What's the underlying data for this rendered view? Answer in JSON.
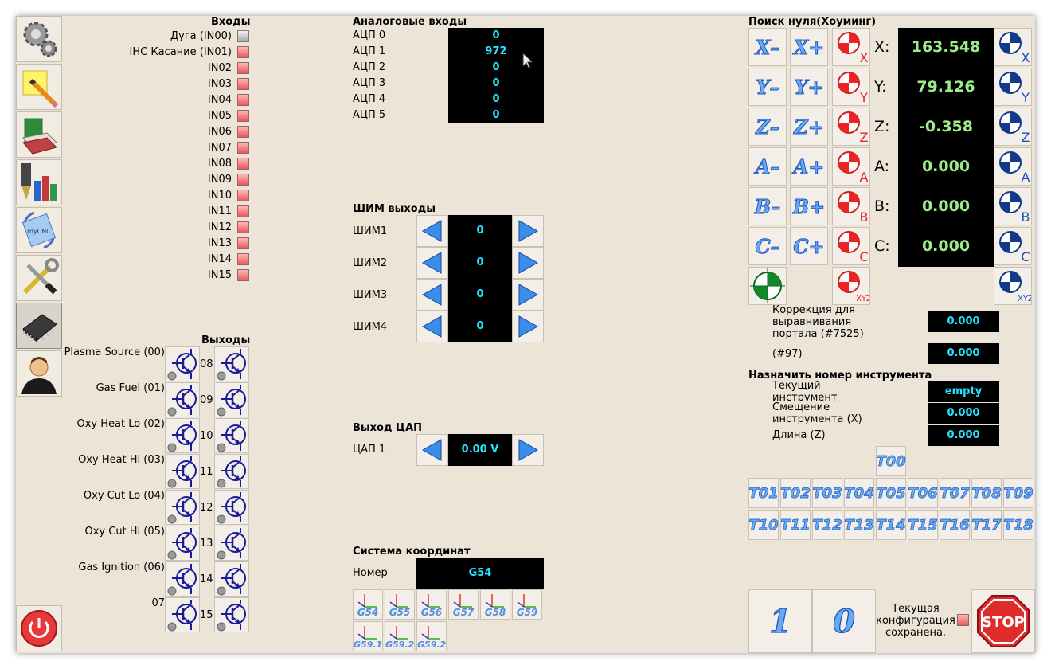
{
  "toolbar": {
    "items": [
      {
        "name": "settings-gears-icon"
      },
      {
        "name": "notes-pencil-icon"
      },
      {
        "name": "books-icon"
      },
      {
        "name": "tool-library-icon"
      },
      {
        "name": "mycnc-rotate-icon"
      },
      {
        "name": "tools-wrench-icon"
      },
      {
        "name": "chip-icon"
      },
      {
        "name": "user-icon"
      }
    ],
    "mycnc_label": "myCNC",
    "power_icon": "power-icon"
  },
  "inputs": {
    "title": "Входы",
    "items": [
      {
        "label": "Дуга (IN00)",
        "state": "gray"
      },
      {
        "label": "IHC Касание (IN01)",
        "state": "red"
      },
      {
        "label": "IN02",
        "state": "red"
      },
      {
        "label": "IN03",
        "state": "red"
      },
      {
        "label": "IN04",
        "state": "red"
      },
      {
        "label": "IN05",
        "state": "red"
      },
      {
        "label": "IN06",
        "state": "red"
      },
      {
        "label": "IN07",
        "state": "red"
      },
      {
        "label": "IN08",
        "state": "red"
      },
      {
        "label": "IN09",
        "state": "red"
      },
      {
        "label": "IN10",
        "state": "red"
      },
      {
        "label": "IN11",
        "state": "red"
      },
      {
        "label": "IN12",
        "state": "red"
      },
      {
        "label": "IN13",
        "state": "red"
      },
      {
        "label": "IN14",
        "state": "red"
      },
      {
        "label": "IN15",
        "state": "red"
      }
    ]
  },
  "outputs": {
    "title": "Выходы",
    "left_labels": [
      "Plasma Source (00)",
      "Gas Fuel (01)",
      "Oxy Heat Lo (02)",
      "Oxy Heat Hi (03)",
      "Oxy Cut Lo (04)",
      "Oxy Cut Hi (05)",
      "Gas Ignition (06)",
      "07"
    ],
    "right_labels": [
      "08",
      "09",
      "10",
      "11",
      "12",
      "13",
      "14",
      "15"
    ]
  },
  "analog": {
    "title": "Аналоговые входы",
    "items": [
      {
        "label": "АЦП 0",
        "value": "0"
      },
      {
        "label": "АЦП 1",
        "value": "972"
      },
      {
        "label": "АЦП 2",
        "value": "0"
      },
      {
        "label": "АЦП 3",
        "value": "0"
      },
      {
        "label": "АЦП 4",
        "value": "0"
      },
      {
        "label": "АЦП 5",
        "value": "0"
      }
    ]
  },
  "pwm": {
    "title": "ШИМ выходы",
    "items": [
      {
        "label": "ШИМ1",
        "value": "0"
      },
      {
        "label": "ШИМ2",
        "value": "0"
      },
      {
        "label": "ШИМ3",
        "value": "0"
      },
      {
        "label": "ШИМ4",
        "value": "0"
      }
    ]
  },
  "dac": {
    "title": "Выход ЦАП",
    "label": "ЦАП 1",
    "value": "0.00 V"
  },
  "coords": {
    "title": "Система координат",
    "label": "Номер",
    "value": "G54",
    "buttons_row1": [
      "G54",
      "G55",
      "G56",
      "G57",
      "G58",
      "G59"
    ],
    "buttons_row2": [
      "G59.1",
      "G59.2",
      "G59.2"
    ]
  },
  "homing": {
    "title": "Поиск нуля(Хоуминг)",
    "jog": [
      {
        "minus": "X–",
        "plus": "X+",
        "axis": "X"
      },
      {
        "minus": "Y–",
        "plus": "Y+",
        "axis": "Y"
      },
      {
        "minus": "Z–",
        "plus": "Z+",
        "axis": "Z"
      },
      {
        "minus": "A–",
        "plus": "A+",
        "axis": "A"
      },
      {
        "minus": "B–",
        "plus": "B+",
        "axis": "B"
      },
      {
        "minus": "C–",
        "plus": "C+",
        "axis": "C"
      }
    ],
    "xyz_label": "XYZ",
    "dro": [
      {
        "axis": "X:",
        "value": "163.548"
      },
      {
        "axis": "Y:",
        "value": "79.126"
      },
      {
        "axis": "Z:",
        "value": "-0.358"
      },
      {
        "axis": "A:",
        "value": "0.000"
      },
      {
        "axis": "B:",
        "value": "0.000"
      },
      {
        "axis": "C:",
        "value": "0.000"
      }
    ]
  },
  "gantry": {
    "label": "Коррекция для выравнивания портала (#7525)",
    "value": "0.000",
    "p97_label": "(#97)",
    "p97_value": "0.000"
  },
  "tool": {
    "title": "Назначить номер инструмента",
    "current_label": "Текущий инструмент",
    "current_value": "empty",
    "offset_label": "Смещение инструмента (X)",
    "offset_value": "0.000",
    "length_label": "Длина (Z)",
    "length_value": "0.000",
    "t00": "T00",
    "row1": [
      "T01",
      "T02",
      "T03",
      "T04",
      "T05",
      "T06",
      "T07",
      "T08",
      "T09"
    ],
    "row2": [
      "T10",
      "T11",
      "T12",
      "T13",
      "T14",
      "T15",
      "T16",
      "T17",
      "T18"
    ]
  },
  "bottom": {
    "btn1": "1",
    "btn0": "0",
    "saved_text": "Текущая конфигурация сохранена.",
    "stop_label": "STOP"
  },
  "colors": {
    "accent": "#6aa9f2",
    "cyan": "#23e3ff",
    "dro_green": "#9cec8a",
    "panel": "#ece4d6"
  }
}
